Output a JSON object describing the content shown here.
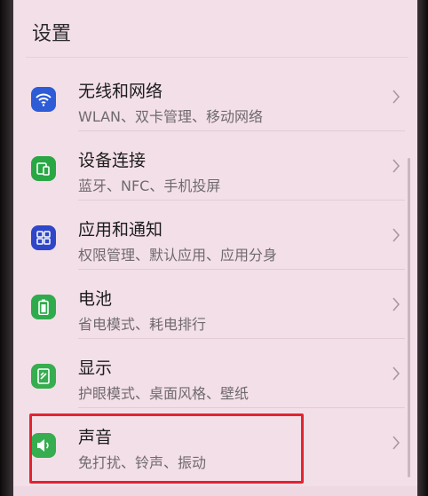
{
  "header": {
    "title": "设置"
  },
  "settings": {
    "items": [
      {
        "label": "无线和网络",
        "sub": "WLAN、双卡管理、移动网络",
        "icon": "wifi-icon",
        "color": "#2e5bd6"
      },
      {
        "label": "设备连接",
        "sub": "蓝牙、NFC、手机投屏",
        "icon": "device-connection-icon",
        "color": "#29a745"
      },
      {
        "label": "应用和通知",
        "sub": "权限管理、默认应用、应用分身",
        "icon": "apps-grid-icon",
        "color": "#2f46c9"
      },
      {
        "label": "电池",
        "sub": "省电模式、耗电排行",
        "icon": "battery-icon",
        "color": "#2fab4d"
      },
      {
        "label": "显示",
        "sub": "护眼模式、桌面风格、壁纸",
        "icon": "display-icon",
        "color": "#36ad4f"
      },
      {
        "label": "声音",
        "sub": "免打扰、铃声、振动",
        "icon": "speaker-icon",
        "color": "#36ad4f"
      }
    ]
  },
  "colors": {
    "background": "#f3dfe8",
    "highlight": "#e1242f"
  }
}
